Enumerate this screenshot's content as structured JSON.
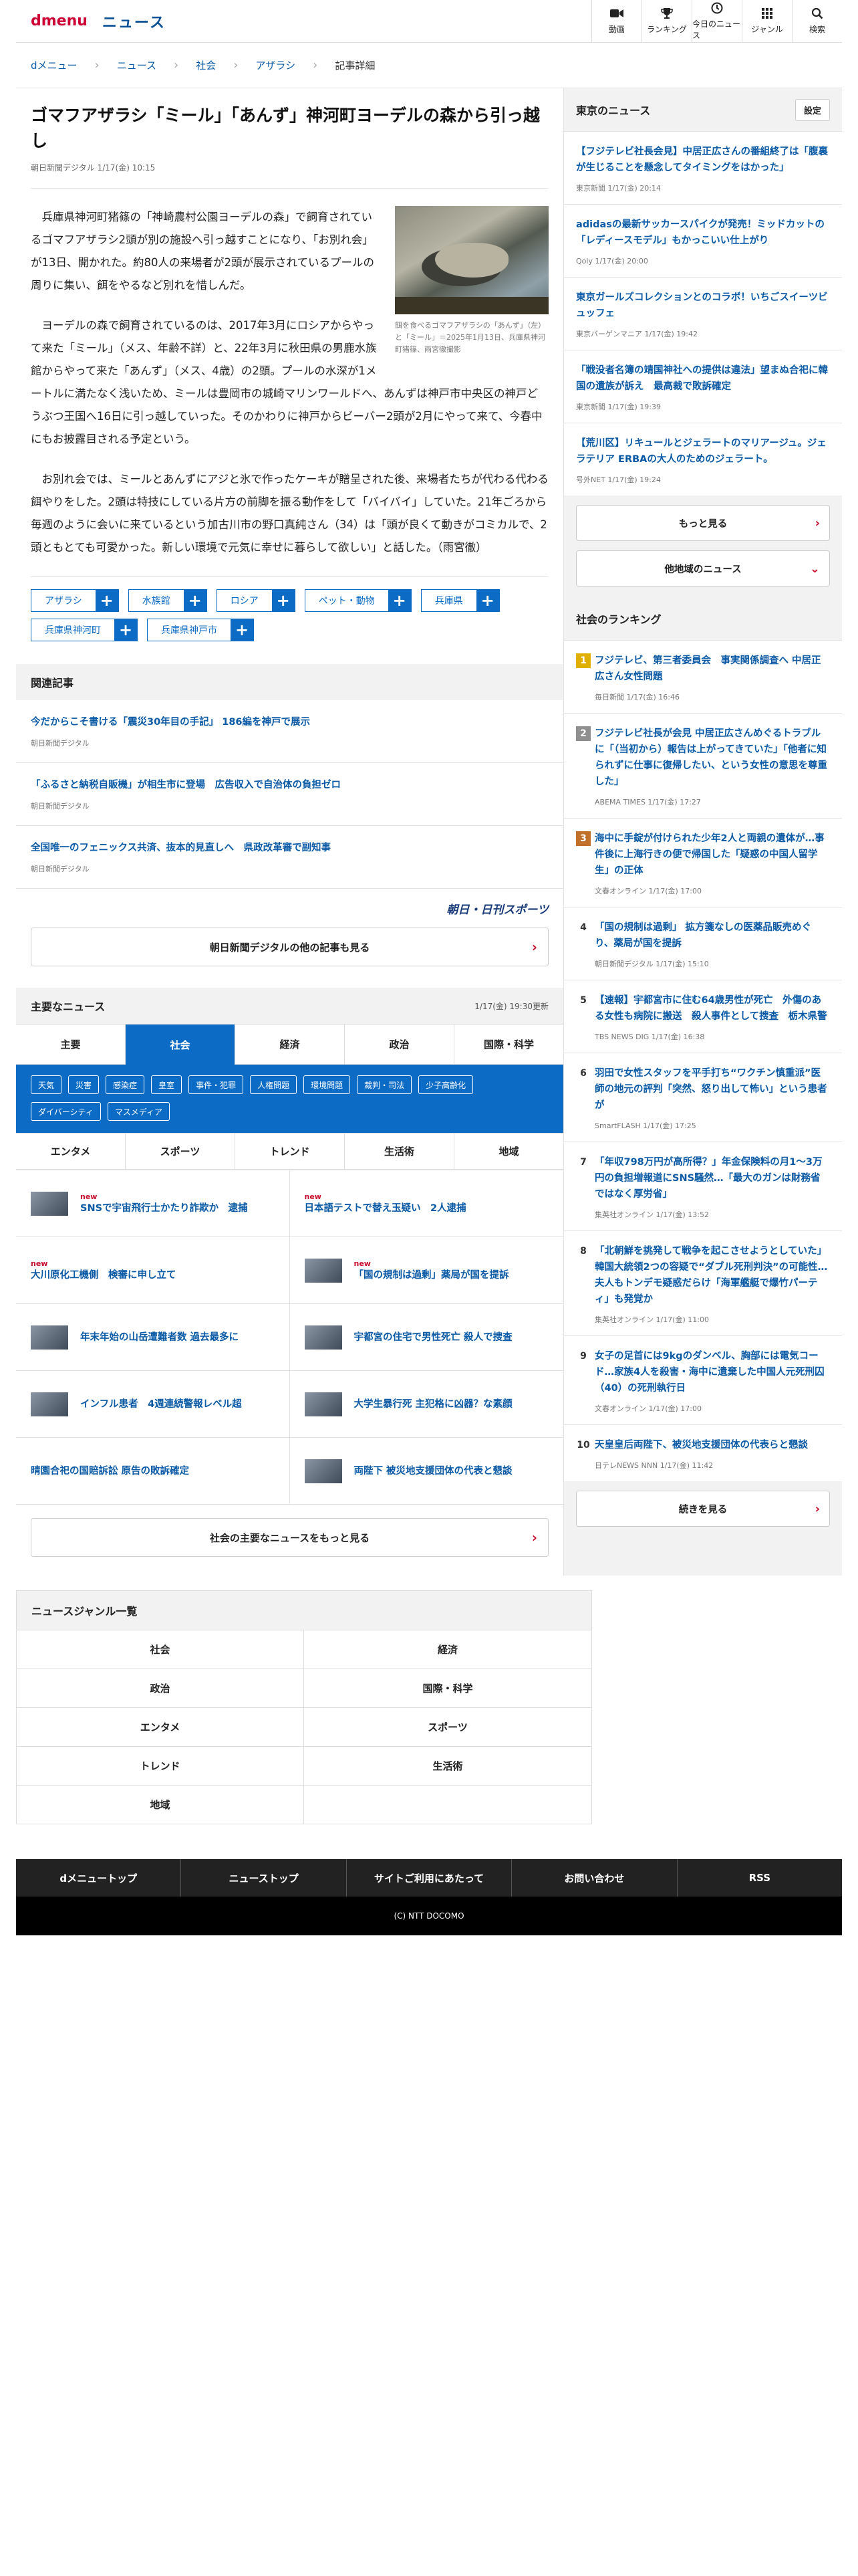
{
  "header": {
    "logo_d": "dmenu",
    "logo_news": "ニュース",
    "nav": [
      {
        "label": "動画",
        "icon": "video-camera-icon"
      },
      {
        "label": "ランキング",
        "icon": "trophy-icon"
      },
      {
        "label": "今日のニュース",
        "icon": "clock-icon"
      },
      {
        "label": "ジャンル",
        "icon": "grid-icon"
      },
      {
        "label": "検索",
        "icon": "search-icon"
      }
    ]
  },
  "breadcrumb": [
    "dメニュー",
    "ニュース",
    "社会",
    "アザラシ",
    "記事詳細"
  ],
  "article": {
    "title": "ゴマフアザラシ「ミール」「あんず」神河町ヨーデルの森から引っ越し",
    "meta": "朝日新聞デジタル 1/17(金) 10:15",
    "photo_caption": "餌を食べるゴマフアザラシの「あんず」（左）と「ミール」＝2025年1月13日、兵庫県神河町猪篠、雨宮徹撮影",
    "paragraphs": [
      "兵庫県神河町猪篠の「神崎農村公園ヨーデルの森」で飼育されているゴマフアザラシ2頭が別の施設へ引っ越すことになり、「お別れ会」が13日、開かれた。約80人の来場者が2頭が展示されているプールの周りに集い、餌をやるなど別れを惜しんだ。",
      "ヨーデルの森で飼育されているのは、2017年3月にロシアからやって来た「ミール」（メス、年齢不詳）と、22年3月に秋田県の男鹿水族館からやって来た「あんず」（メス、4歳）の2頭。プールの水深が1メートルに満たなく浅いため、ミールは豊岡市の城崎マリンワールドへ、あんずは神戸市中央区の神戸どうぶつ王国へ16日に引っ越していった。そのかわりに神戸からビーバー2頭が2月にやって来て、今春中にもお披露目される予定という。",
      "お別れ会では、ミールとあんずにアジと氷で作ったケーキが贈呈された後、来場者たちが代わる代わる餌やりをした。2頭は特技にしている片方の前脚を振る動作をして「バイバイ」していた。21年ごろから毎週のように会いに来ているという加古川市の野口真純さん（34）は「頭が良くて動きがコミカルで、2頭ともとても可愛かった。新しい環境で元気に幸せに暮らして欲しい」と話した。（雨宮徹）"
    ],
    "tags": [
      "アザラシ",
      "水族館",
      "ロシア",
      "ペット・動物",
      "兵庫県",
      "兵庫県神河町",
      "兵庫県神戸市"
    ]
  },
  "related": {
    "heading": "関連記事",
    "items": [
      {
        "title": "今だからこそ書ける「震災30年目の手記」 186編を神戸で展示",
        "source": "朝日新聞デジタル"
      },
      {
        "title": "「ふるさと納税自販機」が相生市に登場　広告収入で自治体の負担ゼロ",
        "source": "朝日新聞デジタル"
      },
      {
        "title": "全国唯一のフェニックス共済、抜本的見直しへ　県政改革審で副知事",
        "source": "朝日新聞デジタル"
      }
    ],
    "brand": "朝日・日刊スポーツ",
    "more": "朝日新聞デジタルの他の記事も見る"
  },
  "main_news": {
    "heading": "主要なニュース",
    "timestamp": "1/17(金) 19:30更新",
    "tabs": [
      "主要",
      "社会",
      "経済",
      "政治",
      "国際・科学"
    ],
    "chips": [
      "天気",
      "災害",
      "感染症",
      "皇室",
      "事件・犯罪",
      "人権問題",
      "環境問題",
      "裁判・司法",
      "少子高齢化",
      "ダイバーシティ",
      "マスメディア"
    ],
    "tabs2": [
      "エンタメ",
      "スポーツ",
      "トレンド",
      "生活術",
      "地域"
    ],
    "items": [
      {
        "title": "SNSで宇宙飛行士かたり詐欺か　逮捕",
        "new": "new"
      },
      {
        "title": "日本語テストで替え玉疑い　2人逮捕",
        "new": "new"
      },
      {
        "title": "大川原化工機側　検審に申し立て",
        "new": "new"
      },
      {
        "title": "「国の規制は過剰」薬局が国を提訴",
        "new": "new"
      },
      {
        "title": "年末年始の山岳遭難者数 過去最多に",
        "new": ""
      },
      {
        "title": "宇都宮の住宅で男性死亡 殺人で捜査",
        "new": ""
      },
      {
        "title": "インフル患者　4週連続警報レベル超",
        "new": ""
      },
      {
        "title": "大学生暴行死 主犯格に凶器？な素顔",
        "new": ""
      },
      {
        "title": "晴園合祀の国賠訴訟 原告の敗訴確定",
        "new": ""
      },
      {
        "title": "両陛下 被災地支援団体の代表と懇談",
        "new": ""
      }
    ],
    "more": "社会の主要なニュースをもっと見る"
  },
  "sidebar": {
    "tokyo_heading": "東京のニュース",
    "settings": "設定",
    "tokyo": [
      {
        "title": "【フジテレビ社長会見】中居正広さんの番組終了は「腹裏が生じることを懸念してタイミングをはかった」",
        "source": "東京新聞 1/17(金) 20:14"
      },
      {
        "title": "adidasの最新サッカースパイクが発売！ミッドカットの「レディースモデル」もかっこいい仕上がり",
        "source": "Qoly 1/17(金) 20:00"
      },
      {
        "title": "東京ガールズコレクションとのコラボ！いちごスイーツビュッフェ",
        "source": "東京バーゲンマニア 1/17(金) 19:42"
      },
      {
        "title": "「戦没者名簿の靖国神社への提供は違法」望まぬ合祀に韓国の遺族が訴え　最高裁で敗訴確定",
        "source": "東京新聞 1/17(金) 19:39"
      },
      {
        "title": "【荒川区】リキュールとジェラートのマリアージュ。ジェラテリア ERBAの大人のためのジェラート。",
        "source": "号外NET 1/17(金) 19:24"
      }
    ],
    "more": "もっと見る",
    "other_area": "他地域のニュース",
    "ranking_heading": "社会のランキング",
    "ranking": [
      {
        "title": "フジテレビ、第三者委員会　事実関係調査へ 中居正広さん女性問題",
        "source": "毎日新聞 1/17(金) 16:46"
      },
      {
        "title": "フジテレビ社長が会見 中居正広さんめぐるトラブルに「（当初から）報告は上がってきていた」「他者に知られずに仕事に復帰したい、という女性の意思を尊重した」",
        "source": "ABEMA TIMES 1/17(金) 17:27"
      },
      {
        "title": "海中に手錠が付けられた少年2人と両親の遺体が…事件後に上海行きの便で帰国した「疑惑の中国人留学生」の正体",
        "source": "文春オンライン 1/17(金) 17:00"
      },
      {
        "title": "「国の規制は過剰」 拡方箋なしの医薬品販売めぐり、薬局が国を提訴",
        "source": "朝日新聞デジタル 1/17(金) 15:10"
      },
      {
        "title": "【速報】宇都宮市に住む64歳男性が死亡　外傷のある女性も病院に搬送　殺人事件として捜査　栃木県警",
        "source": "TBS NEWS DIG 1/17(金) 16:38"
      },
      {
        "title": "羽田で女性スタッフを平手打ち“ワクチン慎重派”医師の地元の評判「突然、怒り出して怖い」という患者が",
        "source": "SmartFLASH 1/17(金) 17:25"
      },
      {
        "title": "「年収798万円が高所得？」年金保険料の月1～3万円の負担増報道にSNS騒然…「最大のガンは財務省ではなく厚労省」",
        "source": "集英社オンライン 1/17(金) 13:52"
      },
      {
        "title": "「北朝鮮を挑発して戦争を起こさせようとしていた」韓国大統領2つの容疑で“ダブル死刑判決”の可能性…夫人もトンデモ疑惑だらけ「海軍艦艇で爆竹パーティ」も発覚か",
        "source": "集英社オンライン 1/17(金) 11:00"
      },
      {
        "title": "女子の足首には9kgのダンベル、胸部には電気コード…家族4人を殺害・海中に遺棄した中国人元死刑囚（40）の死刑執行日",
        "source": "文春オンライン 1/17(金) 17:00"
      },
      {
        "title": "天皇皇后両陛下、被災地支援団体の代表らと懇談",
        "source": "日テレNEWS NNN 1/17(金) 11:42"
      }
    ],
    "ranking_more": "続きを見る"
  },
  "genres": {
    "heading": "ニュースジャンル一覧",
    "items": [
      "社会",
      "経済",
      "政治",
      "国際・科学",
      "エンタメ",
      "スポーツ",
      "トレンド",
      "生活術",
      "地域",
      ""
    ]
  },
  "footer": {
    "links": [
      "dメニュートップ",
      "ニューストップ",
      "サイトご利用にあたって",
      "お問い合わせ",
      "RSS"
    ],
    "copyright": "(C) NTT DOCOMO"
  },
  "colors": {
    "brand_red": "#cc0033",
    "link_blue": "#0b5aa5",
    "accent_blue": "#0b6bc5"
  }
}
